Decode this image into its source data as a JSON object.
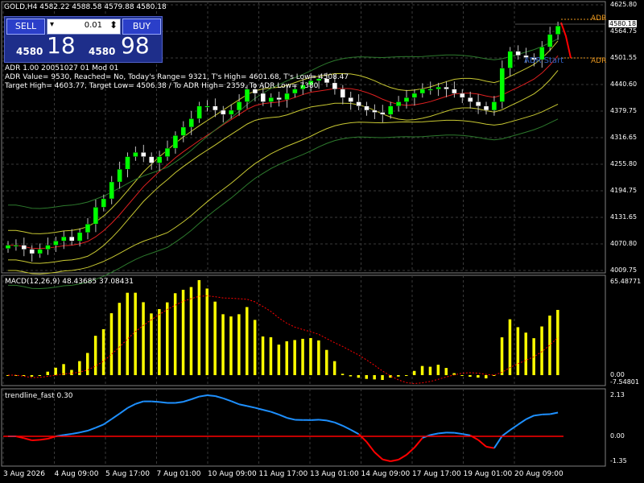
{
  "window": {
    "symbol_header": "GOLD,H4  4582.22 4588.58 4579.88 4580.18"
  },
  "trade_panel": {
    "sell_label": "SELL",
    "buy_label": "BUY",
    "lot_value": "0.01",
    "bid_small": "4580",
    "bid_big": "18",
    "ask_small": "4580",
    "ask_big": "98"
  },
  "adr_info": {
    "line1": "ADR 1.00 20051027 01 Mod 01",
    "line2": "ADR Value= 9530, Reached= No, Today's Range= 9321, T's High= 4601.68, T's Low= 4508.47",
    "line3": "Target High= 4603.77, Target Low= 4506.38 / To ADR High= 2359, To ADR Low= 7380"
  },
  "chart_labels": {
    "adr_high": "ADR",
    "adr_low": "ADR",
    "adr_start": "ADR Start"
  },
  "price_axis": {
    "ticks": [
      "4625.80",
      "4564.75",
      "4501.55",
      "4440.60",
      "4379.75",
      "4316.65",
      "4255.80",
      "4194.75",
      "4131.65",
      "4070.80",
      "4009.75"
    ],
    "current_price": "4580.18"
  },
  "macd": {
    "label": "MACD(12,26,9) 48.43685 37.08431",
    "ticks": [
      "65.48771",
      "0.00",
      "-7.54801"
    ]
  },
  "trendline": {
    "label": "trendline_fast 0.30",
    "ticks": [
      "2.13",
      "0.00",
      "-1.35"
    ]
  },
  "time_axis": {
    "ticks": [
      "3 Aug 2026",
      "4 Aug 09:00",
      "5 Aug 17:00",
      "7 Aug 01:00",
      "10 Aug 09:00",
      "11 Aug 17:00",
      "13 Aug 01:00",
      "14 Aug 09:00",
      "17 Aug 17:00",
      "19 Aug 01:00",
      "20 Aug 09:00"
    ]
  },
  "colors": {
    "bull_candle": "#00ff00",
    "bear_candle": "#ffffff",
    "macd_bars": "#ffff00",
    "signal_line": "#ff0000",
    "grid": "#3a3a3a",
    "band_outer": "#2d7a2d",
    "band_inner": "#c8c832",
    "trend_up": "#1e90ff",
    "trend_down": "#ff0000",
    "adr_text": "#e8961e"
  },
  "chart_data": {
    "type": "candlestick",
    "ylim": [
      4000,
      4630
    ],
    "closes": [
      4060,
      4060,
      4050,
      4040,
      4050,
      4060,
      4070,
      4080,
      4070,
      4090,
      4110,
      4150,
      4170,
      4210,
      4240,
      4270,
      4280,
      4270,
      4255,
      4270,
      4290,
      4320,
      4340,
      4360,
      4390,
      4390,
      4380,
      4370,
      4380,
      4400,
      4430,
      4420,
      4400,
      4410,
      4405,
      4420,
      4430,
      4440,
      4450,
      4455,
      4445,
      4430,
      4410,
      4400,
      4390,
      4380,
      4375,
      4370,
      4390,
      4400,
      4410,
      4420,
      4430,
      4430,
      4435,
      4430,
      4420,
      4410,
      4400,
      4390,
      4380,
      4400,
      4480,
      4520,
      4510,
      4505,
      4500,
      4530,
      4560,
      4580
    ]
  }
}
